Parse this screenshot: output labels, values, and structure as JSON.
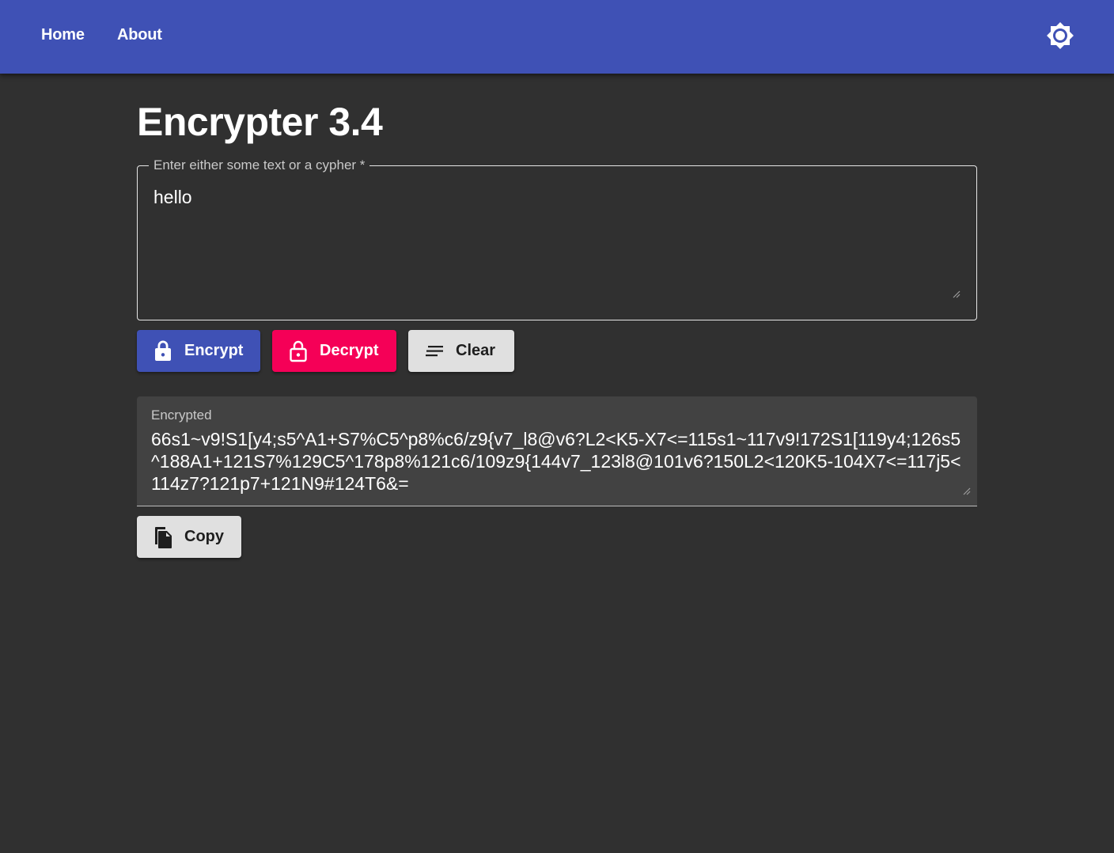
{
  "nav": {
    "home_label": "Home",
    "about_label": "About",
    "theme_icon": "brightness-icon"
  },
  "colors": {
    "appbar": "#3f51b5",
    "background": "#303030",
    "encrypt_button": "#3f51b5",
    "decrypt_button": "#f50057",
    "neutral_button": "#e0e0e0",
    "output_background": "#424242"
  },
  "page": {
    "title": "Encrypter 3.4"
  },
  "input": {
    "label": "Enter either some text or a cypher *",
    "value": "hello"
  },
  "actions": {
    "encrypt_label": "Encrypt",
    "encrypt_icon": "lock-icon",
    "decrypt_label": "Decrypt",
    "decrypt_icon": "lock-open-icon",
    "clear_label": "Clear",
    "clear_icon": "short-text-icon"
  },
  "output": {
    "label": "Encrypted",
    "value": "66s1~v9!S1[y4;s5^A1+S7%C5^p8%c6/z9{v7_l8@v6?L2<K5-X7<=115s1~117v9!172S1[119y4;126s5^188A1+121S7%129C5^178p8%121c6/109z9{144v7_123l8@101v6?150L2<120K5-104X7<=117j5<114z7?121p7+121N9#124T6&="
  },
  "copy": {
    "label": "Copy",
    "icon": "copy-icon"
  }
}
